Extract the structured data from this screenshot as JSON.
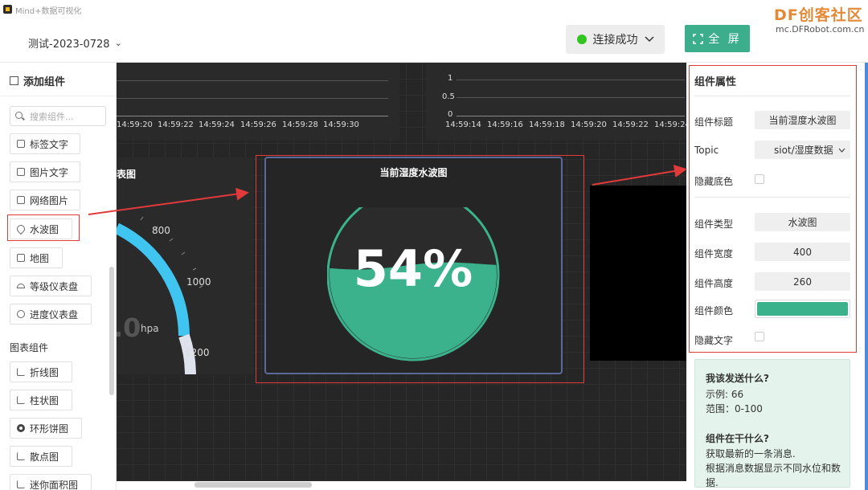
{
  "app": {
    "title": "Mind+数据可视化",
    "logo_icon": "app-logo-icon"
  },
  "header": {
    "project_name": "测试-2023-0728",
    "connection_status": "连接成功",
    "fullscreen_label": "全 屏",
    "status_color": "#32c51f",
    "accent": "#3cae8c"
  },
  "watermark": {
    "brand": "DF创客社区",
    "url": "mc.DFRobot.com.cn"
  },
  "sidebar": {
    "title": "添加组件",
    "search_placeholder": "搜索组件...",
    "items": [
      {
        "label": "标签文字",
        "icon": "text-label-icon"
      },
      {
        "label": "图片文字",
        "icon": "image-text-icon"
      },
      {
        "label": "网络图片",
        "icon": "web-image-icon"
      },
      {
        "label": "水波图",
        "icon": "water-drop-icon"
      },
      {
        "label": "地图",
        "icon": "map-icon"
      },
      {
        "label": "等级仪表盘",
        "icon": "gauge-icon"
      },
      {
        "label": "进度仪表盘",
        "icon": "progress-gauge-icon"
      }
    ],
    "chart_section": "图表组件",
    "chart_items": [
      {
        "label": "折线图",
        "icon": "line-chart-icon"
      },
      {
        "label": "柱状图",
        "icon": "bar-chart-icon"
      },
      {
        "label": "环形饼图",
        "icon": "donut-chart-icon"
      },
      {
        "label": "散点图",
        "icon": "scatter-chart-icon"
      },
      {
        "label": "迷你面积图",
        "icon": "area-chart-icon"
      }
    ]
  },
  "canvas": {
    "chart_left": {
      "x_ticks": [
        "14:59:20",
        "14:59:22",
        "14:59:24",
        "14:59:26",
        "14:59:28",
        "14:59:30"
      ]
    },
    "chart_right": {
      "x_ticks": [
        "14:59:14",
        "14:59:16",
        "14:59:18",
        "14:59:20",
        "14:59:22",
        "14:59:24"
      ],
      "y_ticks": [
        "1",
        "0.5",
        "0"
      ]
    },
    "gauge": {
      "title_fragment": "表图",
      "ticks": [
        "800",
        "1000",
        "1200"
      ],
      "value_fragment": ".0",
      "unit": "hpa",
      "arc_color": "#3fc5f0"
    },
    "wave": {
      "title": "当前湿度水波图",
      "value_text": "54%",
      "level": 0.54,
      "color": "#3bb28c"
    }
  },
  "properties": {
    "title": "组件属性",
    "fields": {
      "title_label": "组件标题",
      "title_value": "当前湿度水波图",
      "topic_label": "Topic",
      "topic_value": "siot/湿度数据",
      "hide_bg_label": "隐藏底色",
      "type_label": "组件类型",
      "type_value": "水波图",
      "width_label": "组件宽度",
      "width_value": "400",
      "height_label": "组件高度",
      "height_value": "260",
      "color_label": "组件颜色",
      "color_value": "#3bb28c",
      "hide_text_label": "隐藏文字"
    },
    "help": {
      "q1": "我该发送什么?",
      "example": "示例: 66",
      "range": "范围：0-100",
      "q2": "组件在干什么?",
      "desc1": "获取最新的一条消息.",
      "desc2": "根据消息数据显示不同水位和数",
      "desc3": "据."
    }
  },
  "annotations": {
    "highlight_color": "#e23a3a"
  }
}
